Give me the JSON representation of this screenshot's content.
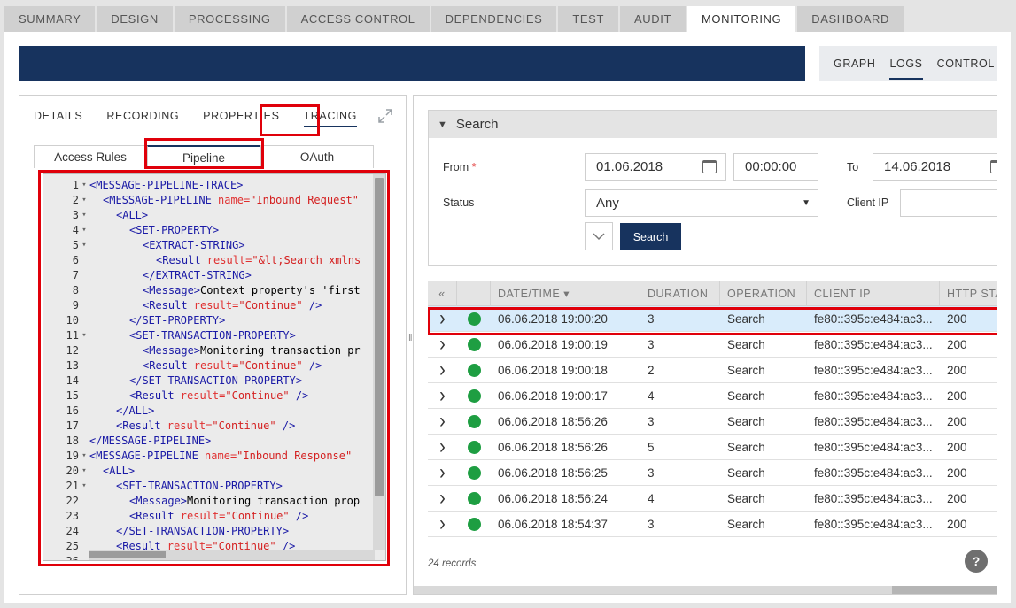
{
  "top_tabs": [
    "SUMMARY",
    "DESIGN",
    "PROCESSING",
    "ACCESS CONTROL",
    "DEPENDENCIES",
    "TEST",
    "AUDIT",
    "MONITORING",
    "DASHBOARD"
  ],
  "active_top_tab": "MONITORING",
  "view_tabs": [
    "GRAPH",
    "LOGS",
    "CONTROL"
  ],
  "active_view_tab": "LOGS",
  "left": {
    "sub_tabs": [
      "DETAILS",
      "RECORDING",
      "PROPERTIES",
      "TRACING"
    ],
    "active_sub_tab": "TRACING",
    "pipeline_tabs": [
      "Access Rules",
      "Pipeline",
      "OAuth"
    ],
    "active_pipeline_tab": "Pipeline"
  },
  "code_lines": [
    {
      "n": "1",
      "fold": "▾",
      "indent": 0,
      "parts": [
        [
          "t",
          "<MESSAGE-PIPELINE-TRACE>"
        ]
      ]
    },
    {
      "n": "2",
      "fold": "▾",
      "indent": 1,
      "parts": [
        [
          "t",
          "<MESSAGE-PIPELINE "
        ],
        [
          "a",
          "name="
        ],
        [
          "s",
          "\"Inbound Request\""
        ]
      ]
    },
    {
      "n": "3",
      "fold": "▾",
      "indent": 2,
      "parts": [
        [
          "t",
          "<ALL>"
        ]
      ]
    },
    {
      "n": "4",
      "fold": "▾",
      "indent": 3,
      "parts": [
        [
          "t",
          "<SET-PROPERTY>"
        ]
      ]
    },
    {
      "n": "5",
      "fold": "▾",
      "indent": 4,
      "parts": [
        [
          "t",
          "<EXTRACT-STRING>"
        ]
      ]
    },
    {
      "n": "6",
      "fold": "",
      "indent": 5,
      "parts": [
        [
          "t",
          "<Result "
        ],
        [
          "a",
          "result="
        ],
        [
          "s",
          "\"&lt;Search xmlns"
        ]
      ]
    },
    {
      "n": "7",
      "fold": "",
      "indent": 4,
      "parts": [
        [
          "t",
          "</EXTRACT-STRING>"
        ]
      ]
    },
    {
      "n": "8",
      "fold": "",
      "indent": 4,
      "parts": [
        [
          "t",
          "<Message>"
        ],
        [
          "x",
          "Context property's 'first"
        ]
      ]
    },
    {
      "n": "9",
      "fold": "",
      "indent": 4,
      "parts": [
        [
          "t",
          "<Result "
        ],
        [
          "a",
          "result="
        ],
        [
          "s",
          "\"Continue\""
        ],
        [
          "t",
          " />"
        ]
      ]
    },
    {
      "n": "10",
      "fold": "",
      "indent": 3,
      "parts": [
        [
          "t",
          "</SET-PROPERTY>"
        ]
      ]
    },
    {
      "n": "11",
      "fold": "▾",
      "indent": 3,
      "parts": [
        [
          "t",
          "<SET-TRANSACTION-PROPERTY>"
        ]
      ]
    },
    {
      "n": "12",
      "fold": "",
      "indent": 4,
      "parts": [
        [
          "t",
          "<Message>"
        ],
        [
          "x",
          "Monitoring transaction pr"
        ]
      ]
    },
    {
      "n": "13",
      "fold": "",
      "indent": 4,
      "parts": [
        [
          "t",
          "<Result "
        ],
        [
          "a",
          "result="
        ],
        [
          "s",
          "\"Continue\""
        ],
        [
          "t",
          " />"
        ]
      ]
    },
    {
      "n": "14",
      "fold": "",
      "indent": 3,
      "parts": [
        [
          "t",
          "</SET-TRANSACTION-PROPERTY>"
        ]
      ]
    },
    {
      "n": "15",
      "fold": "",
      "indent": 3,
      "parts": [
        [
          "t",
          "<Result "
        ],
        [
          "a",
          "result="
        ],
        [
          "s",
          "\"Continue\""
        ],
        [
          "t",
          " />"
        ]
      ]
    },
    {
      "n": "16",
      "fold": "",
      "indent": 2,
      "parts": [
        [
          "t",
          "</ALL>"
        ]
      ]
    },
    {
      "n": "17",
      "fold": "",
      "indent": 2,
      "parts": [
        [
          "t",
          "<Result "
        ],
        [
          "a",
          "result="
        ],
        [
          "s",
          "\"Continue\""
        ],
        [
          "t",
          " />"
        ]
      ]
    },
    {
      "n": "18",
      "fold": "",
      "indent": 0,
      "parts": [
        [
          "t",
          "</MESSAGE-PIPELINE>"
        ]
      ]
    },
    {
      "n": "19",
      "fold": "▾",
      "indent": 0,
      "parts": [
        [
          "t",
          "<MESSAGE-PIPELINE "
        ],
        [
          "a",
          "name="
        ],
        [
          "s",
          "\"Inbound Response\""
        ]
      ]
    },
    {
      "n": "20",
      "fold": "▾",
      "indent": 1,
      "parts": [
        [
          "t",
          "<ALL>"
        ]
      ]
    },
    {
      "n": "21",
      "fold": "▾",
      "indent": 2,
      "parts": [
        [
          "t",
          "<SET-TRANSACTION-PROPERTY>"
        ]
      ]
    },
    {
      "n": "22",
      "fold": "",
      "indent": 3,
      "parts": [
        [
          "t",
          "<Message>"
        ],
        [
          "x",
          "Monitoring transaction prop"
        ]
      ]
    },
    {
      "n": "23",
      "fold": "",
      "indent": 3,
      "parts": [
        [
          "t",
          "<Result "
        ],
        [
          "a",
          "result="
        ],
        [
          "s",
          "\"Continue\""
        ],
        [
          "t",
          " />"
        ]
      ]
    },
    {
      "n": "24",
      "fold": "",
      "indent": 2,
      "parts": [
        [
          "t",
          "</SET-TRANSACTION-PROPERTY>"
        ]
      ]
    },
    {
      "n": "25",
      "fold": "",
      "indent": 2,
      "parts": [
        [
          "t",
          "<Result "
        ],
        [
          "a",
          "result="
        ],
        [
          "s",
          "\"Continue\""
        ],
        [
          "t",
          " />"
        ]
      ]
    },
    {
      "n": "26",
      "fold": "",
      "indent": 0,
      "parts": []
    }
  ],
  "search": {
    "title": "Search",
    "from_label": "From",
    "from_required": "*",
    "from_date": "01.06.2018",
    "from_time": "00:00:00",
    "to_label": "To",
    "to_date": "14.06.2018",
    "status_label": "Status",
    "status_value": "Any",
    "client_ip_label": "Client IP",
    "client_ip_value": "",
    "search_button": "Search"
  },
  "grid": {
    "columns": [
      "DATE/TIME ▾",
      "DURATION",
      "OPERATION",
      "CLIENT IP",
      "HTTP STA"
    ],
    "rows": [
      {
        "date": "06.06.2018 19:00:20",
        "duration": "3",
        "operation": "Search",
        "client_ip": "fe80::395c:e484:ac3...",
        "status": "200",
        "selected": true
      },
      {
        "date": "06.06.2018 19:00:19",
        "duration": "3",
        "operation": "Search",
        "client_ip": "fe80::395c:e484:ac3...",
        "status": "200"
      },
      {
        "date": "06.06.2018 19:00:18",
        "duration": "2",
        "operation": "Search",
        "client_ip": "fe80::395c:e484:ac3...",
        "status": "200"
      },
      {
        "date": "06.06.2018 19:00:17",
        "duration": "4",
        "operation": "Search",
        "client_ip": "fe80::395c:e484:ac3...",
        "status": "200"
      },
      {
        "date": "06.06.2018 18:56:26",
        "duration": "3",
        "operation": "Search",
        "client_ip": "fe80::395c:e484:ac3...",
        "status": "200"
      },
      {
        "date": "06.06.2018 18:56:26",
        "duration": "5",
        "operation": "Search",
        "client_ip": "fe80::395c:e484:ac3...",
        "status": "200"
      },
      {
        "date": "06.06.2018 18:56:25",
        "duration": "3",
        "operation": "Search",
        "client_ip": "fe80::395c:e484:ac3...",
        "status": "200"
      },
      {
        "date": "06.06.2018 18:56:24",
        "duration": "4",
        "operation": "Search",
        "client_ip": "fe80::395c:e484:ac3...",
        "status": "200"
      },
      {
        "date": "06.06.2018 18:54:37",
        "duration": "3",
        "operation": "Search",
        "client_ip": "fe80::395c:e484:ac3...",
        "status": "200"
      }
    ],
    "records": "24 records"
  },
  "help_label": "?",
  "colors": {
    "navy": "#17335e",
    "green": "#1e9e42",
    "highlight_red": "#e0000a",
    "selected_row": "#d9ecfb"
  },
  "icons": [
    "calendar-icon",
    "chevron-down-icon",
    "expand-icon",
    "collapse-all-icon",
    "help-icon"
  ]
}
